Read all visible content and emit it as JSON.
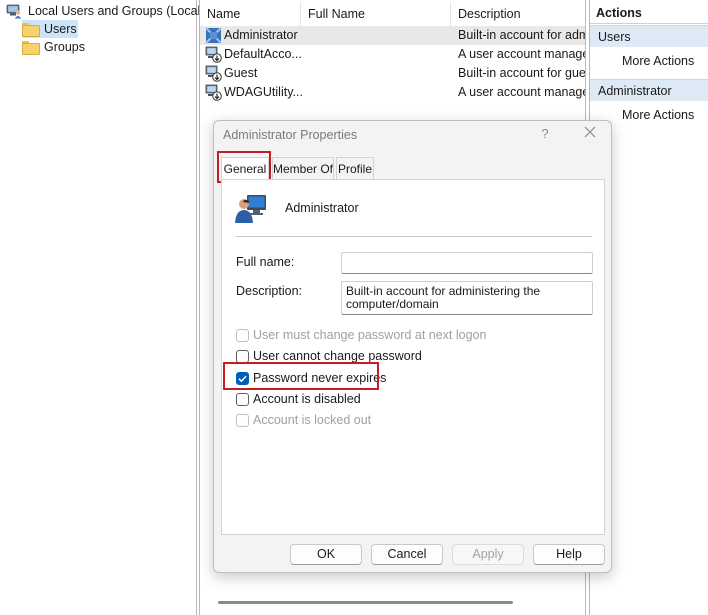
{
  "tree": {
    "root_label": "Local Users and Groups (Local)",
    "items": [
      {
        "label": "Users",
        "selected": true
      },
      {
        "label": "Groups",
        "selected": false
      }
    ]
  },
  "list": {
    "columns": [
      "Name",
      "Full Name",
      "Description"
    ],
    "rows": [
      {
        "name": "Administrator",
        "full_name": "",
        "description": "Built-in account for adm",
        "selected": true
      },
      {
        "name": "DefaultAcco...",
        "full_name": "",
        "description": "A user account manage",
        "selected": false
      },
      {
        "name": "Guest",
        "full_name": "",
        "description": "Built-in account for gue",
        "selected": false
      },
      {
        "name": "WDAGUtility...",
        "full_name": "",
        "description": "A user account manage",
        "selected": false
      }
    ]
  },
  "actions": {
    "title": "Actions",
    "sections": [
      {
        "header": "Users",
        "link": "More Actions"
      },
      {
        "header": "Administrator",
        "link": "More Actions"
      }
    ]
  },
  "dialog": {
    "title": "Administrator Properties",
    "help_glyph": "?",
    "tabs": [
      "General",
      "Member Of",
      "Profile"
    ],
    "active_tab": "General",
    "username": "Administrator",
    "full_name_label": "Full name:",
    "full_name_value": "",
    "description_label": "Description:",
    "description_value": "Built-in account for administering the\ncomputer/domain",
    "checkboxes": [
      {
        "label": "User must change password at next logon",
        "checked": false,
        "disabled": true
      },
      {
        "label": "User cannot change password",
        "checked": false,
        "disabled": false
      },
      {
        "label": "Password never expires",
        "checked": true,
        "disabled": false
      },
      {
        "label": "Account is disabled",
        "checked": false,
        "disabled": false
      },
      {
        "label": "Account is locked out",
        "checked": false,
        "disabled": true
      }
    ],
    "buttons": {
      "ok": "OK",
      "cancel": "Cancel",
      "apply": "Apply",
      "help": "Help"
    }
  },
  "colors": {
    "highlight_red": "#c21d22",
    "selection_blue": "#cce4f7",
    "action_section_bg": "#ddeaf6",
    "checkbox_checked": "#005fb8"
  }
}
